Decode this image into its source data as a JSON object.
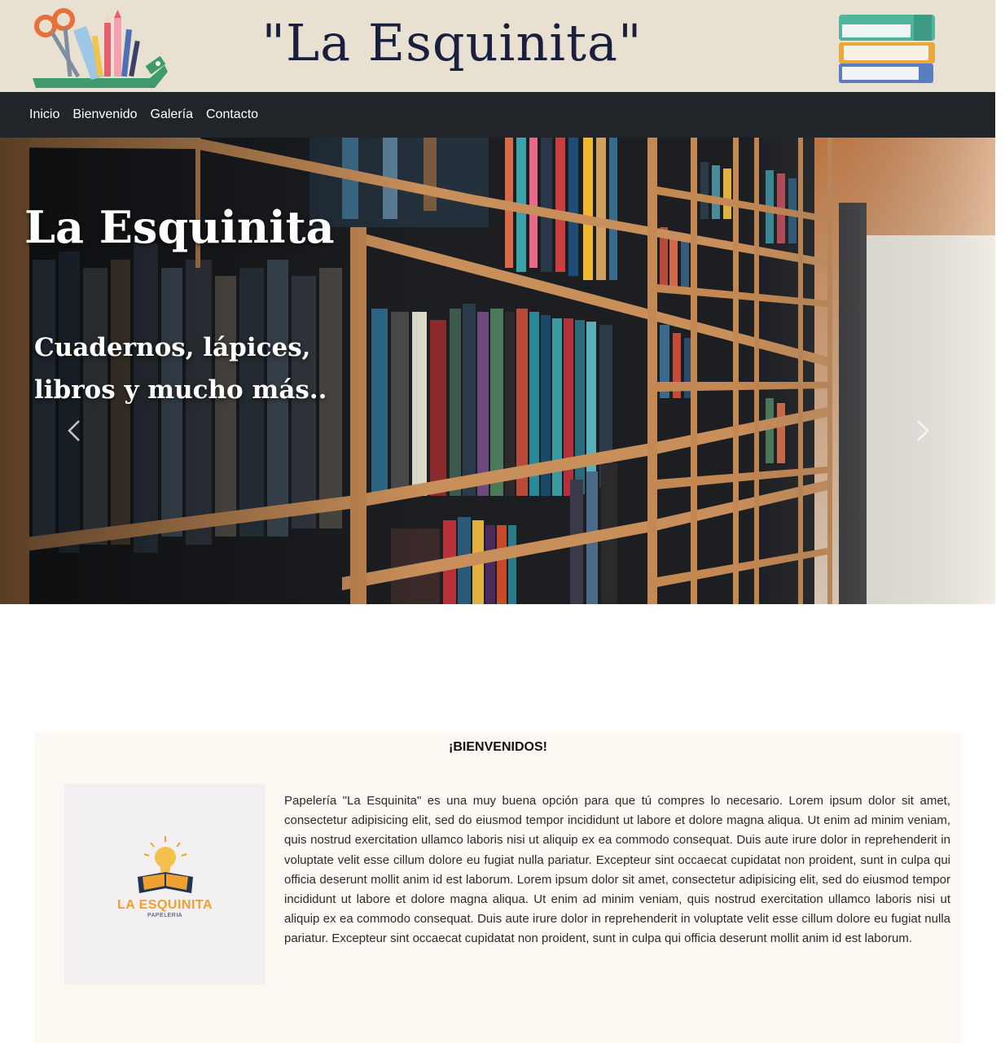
{
  "header": {
    "title": "\"La Esquinita\"",
    "left_icon": "stationery-icon",
    "right_icon": "books-stack-icon",
    "background": "#e8e1d2",
    "title_color": "#1b1f3f"
  },
  "nav": {
    "items": [
      {
        "label": "Inicio"
      },
      {
        "label": "Bienvenido"
      },
      {
        "label": "Galería"
      },
      {
        "label": "Contacto"
      }
    ],
    "background": "#212529"
  },
  "hero": {
    "title": "La Esquinita",
    "subtitle": "Cuadernos, lápices, libros y mucho más..",
    "prev_icon": "chevron-left-icon",
    "next_icon": "chevron-right-icon"
  },
  "welcome": {
    "heading": "¡BIENVENIDOS!",
    "logo_name": "LA ESQUINITA",
    "logo_sub": "PAPELERIA",
    "body": "Papelería \"La Esquinita\" es una muy buena opción para que tú compres lo necesario. Lorem ipsum dolor sit amet, consectetur adipisicing elit, sed do eiusmod tempor incididunt ut labore et dolore magna aliqua. Ut enim ad minim veniam, quis nostrud exercitation ullamco laboris nisi ut aliquip ex ea commodo consequat. Duis aute irure dolor in reprehenderit in voluptate velit esse cillum dolore eu fugiat nulla pariatur. Excepteur sint occaecat cupidatat non proident, sunt in culpa qui officia deserunt mollit anim id est laborum. Lorem ipsum dolor sit amet, consectetur adipisicing elit, sed do eiusmod tempor incididunt ut labore et dolore magna aliqua. Ut enim ad minim veniam, quis nostrud exercitation ullamco laboris nisi ut aliquip ex ea commodo consequat. Duis aute irure dolor in reprehenderit in voluptate velit esse cillum dolore eu fugiat nulla pariatur. Excepteur sint occaecat cupidatat non proident, sunt in culpa qui officia deserunt mollit anim id est laborum.",
    "background": "#fdf8f2",
    "accent": "#f0a030"
  }
}
